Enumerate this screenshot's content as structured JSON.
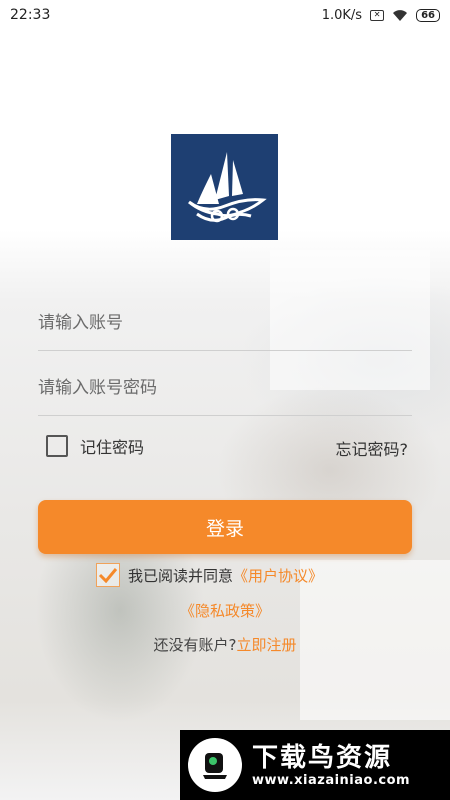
{
  "status_bar": {
    "time": "22:33",
    "speed": "1.0K/s",
    "battery": "66"
  },
  "form": {
    "account_placeholder": "请输入账号",
    "password_placeholder": "请输入账号密码",
    "remember_label": "记住密码",
    "remember_checked": false,
    "forgot_label": "忘记密码?",
    "login_label": "登录"
  },
  "agreement": {
    "checked": true,
    "prefix": "我已阅读并同意",
    "user_agreement": "《用户协议》",
    "privacy_policy": "《隐私政策》"
  },
  "register": {
    "prompt": "还没有账户?",
    "link": "立即注册"
  },
  "watermark": {
    "title": "下载鸟资源",
    "subtitle": "www.xiazainiao.com"
  },
  "colors": {
    "accent": "#f5892a",
    "logo_bg": "#1e3f72"
  }
}
